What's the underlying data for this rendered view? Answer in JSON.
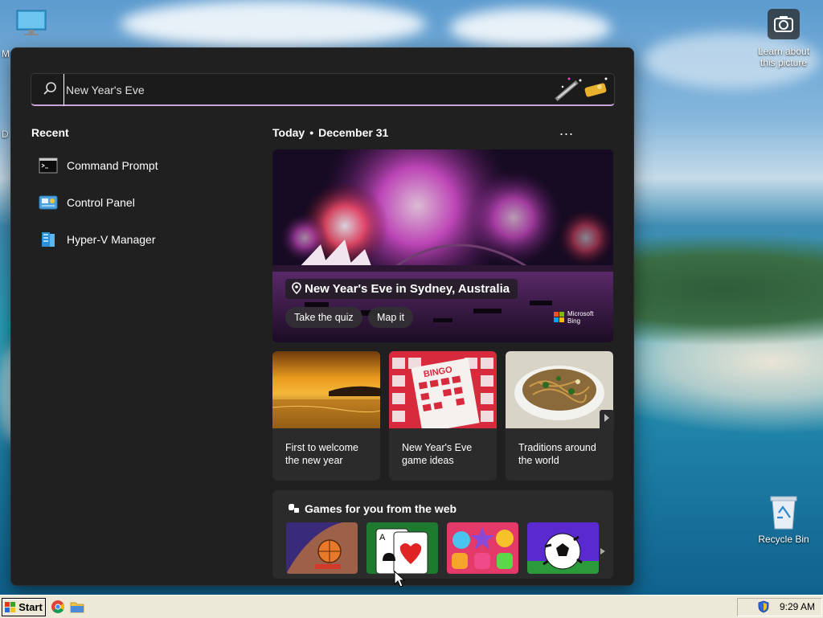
{
  "desktop": {
    "left_icon_fragment_1": "M",
    "left_icon_fragment_2": "D",
    "learn_picture_label": "Learn about this picture",
    "recycle_bin_label": "Recycle Bin"
  },
  "search": {
    "value": "New Year's Eve",
    "highlight_icon": "party-popper-icon"
  },
  "recent": {
    "title": "Recent",
    "items": [
      {
        "label": "Command Prompt",
        "icon": "command-prompt-icon"
      },
      {
        "label": "Control Panel",
        "icon": "control-panel-icon"
      },
      {
        "label": "Hyper-V Manager",
        "icon": "hyper-v-manager-icon"
      }
    ]
  },
  "today": {
    "label": "Today",
    "separator": "•",
    "date": "December 31",
    "more": "..."
  },
  "hero": {
    "title": "New Year's Eve in Sydney, Australia",
    "buttons": [
      "Take the quiz",
      "Map it"
    ],
    "credit_line1": "Microsoft",
    "credit_line2": "Bing"
  },
  "cards": [
    {
      "caption": "First to welcome the new year"
    },
    {
      "caption": "New Year's Eve game ideas"
    },
    {
      "caption": "Traditions around the world"
    }
  ],
  "games": {
    "title": "Games for you from the web"
  },
  "taskbar": {
    "start_label": "Start",
    "clock": "9:29 AM"
  }
}
